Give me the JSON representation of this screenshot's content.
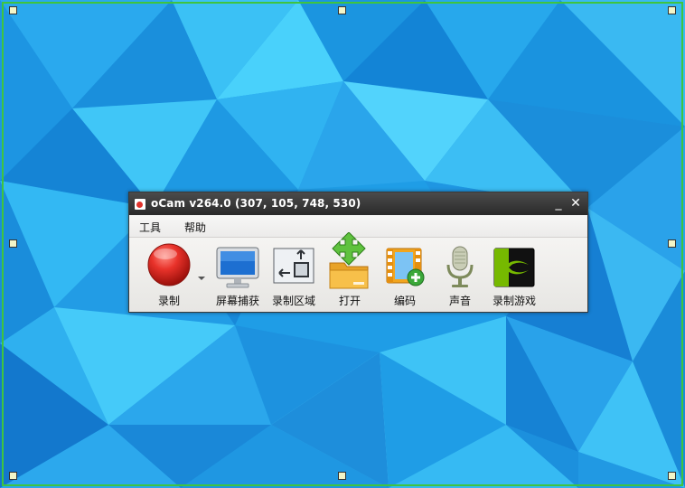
{
  "window": {
    "title": "oCam v264.0 (307, 105, 748, 530)",
    "minimize_symbol": "_",
    "close_symbol": "✕"
  },
  "menu": [
    {
      "label": "工具"
    },
    {
      "label": "帮助"
    }
  ],
  "toolbar": [
    {
      "label": "录制",
      "icon": "record-icon"
    },
    {
      "label": "屏幕捕获",
      "icon": "monitor-icon"
    },
    {
      "label": "录制区域",
      "icon": "resize-region-icon"
    },
    {
      "label": "打开",
      "icon": "folder-open-icon"
    },
    {
      "label": "编码",
      "icon": "film-add-icon"
    },
    {
      "label": "声音",
      "icon": "microphone-icon"
    },
    {
      "label": "录制游戏",
      "icon": "game-nvidia-icon"
    }
  ],
  "colors": {
    "selection_border": "#3fc43f",
    "handle_fill": "#f2f5c8",
    "record_red": "#e1322b"
  }
}
